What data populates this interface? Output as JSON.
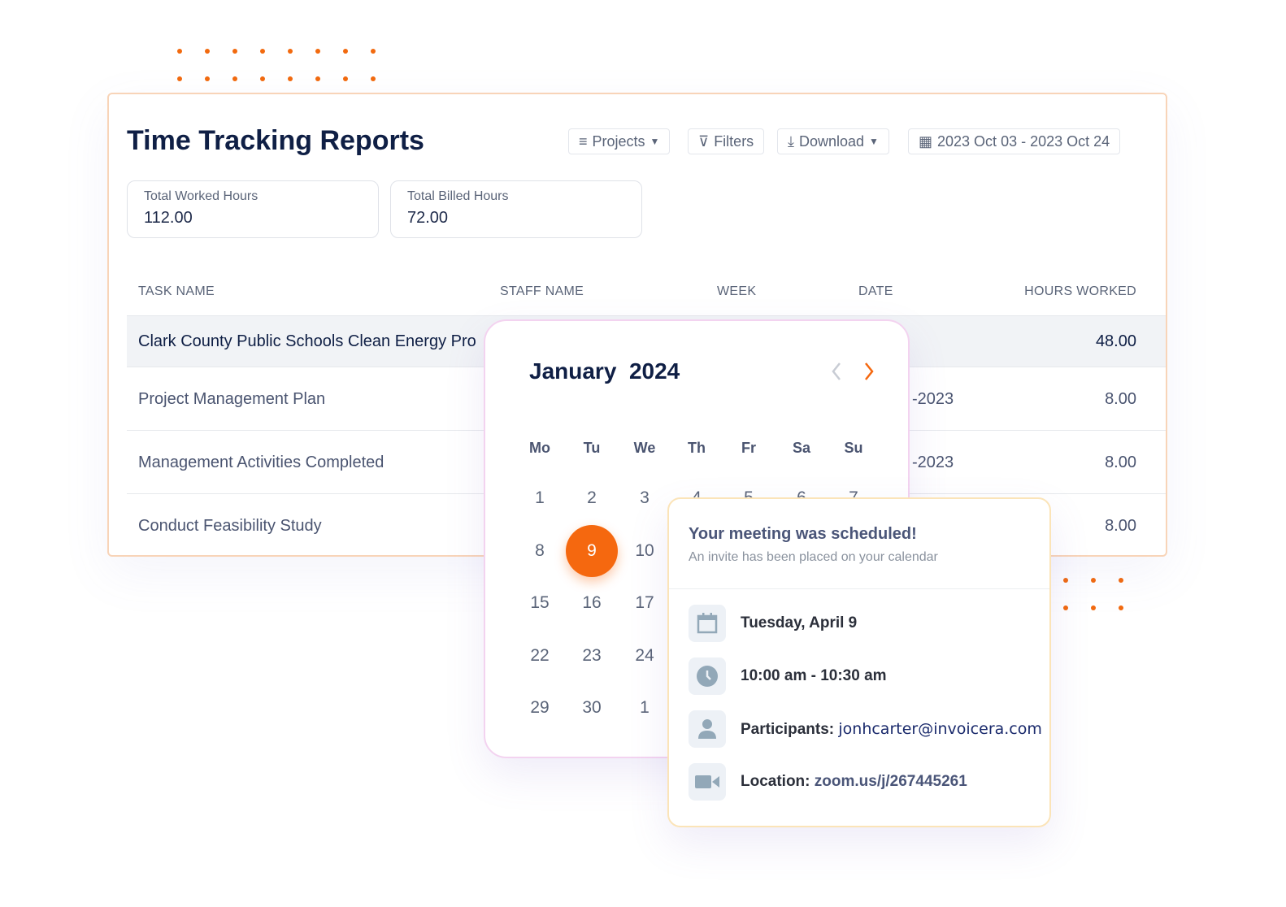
{
  "header": {
    "title": "Time Tracking Reports",
    "projects": "Projects",
    "filters": "Filters",
    "download": "Download",
    "date_range": "2023 Oct 03 - 2023 Oct 24"
  },
  "stats": [
    {
      "label": "Total Worked Hours",
      "value": "112.00"
    },
    {
      "label": "Total Billed Hours",
      "value": "72.00"
    }
  ],
  "table": {
    "headers": [
      "TASK NAME",
      "STAFF NAME",
      "WEEK",
      "DATE",
      "HOURS WORKED"
    ],
    "rows": [
      {
        "task": "Clark County Public Schools Clean Energy Pro",
        "date": "",
        "hours": "48.00"
      },
      {
        "task": "Project Management Plan",
        "date": "-2023",
        "hours": "8.00"
      },
      {
        "task": "Management Activities Completed",
        "date": "-2023",
        "hours": "8.00"
      },
      {
        "task": "Conduct Feasibility Study",
        "date": "",
        "hours": "8.00"
      }
    ]
  },
  "calendar": {
    "month": "January  2024",
    "weekdays": [
      "Mo",
      "Tu",
      "We",
      "Th",
      "Fr",
      "Sa",
      "Su"
    ],
    "selected": "9",
    "accent": "#f5680f",
    "weeks": [
      [
        "1",
        "2",
        "3",
        "4",
        "5",
        "6",
        "7"
      ],
      [
        "8",
        "9",
        "10",
        "",
        "",
        "",
        ""
      ],
      [
        "15",
        "16",
        "17",
        "",
        "",
        "",
        ""
      ],
      [
        "22",
        "23",
        "24",
        "",
        "",
        "",
        ""
      ],
      [
        "29",
        "30",
        "1",
        "",
        "",
        "",
        ""
      ]
    ]
  },
  "meeting": {
    "title": "Your meeting was scheduled!",
    "subtitle": "An invite has been placed on your calendar",
    "date": "Tuesday, April 9",
    "time": "10:00 am - 10:30 am",
    "participants_label": "Participants:",
    "participants": "jonhcarter@invoicera.com",
    "location_label": "Location:",
    "location": "zoom.us/j/267445261"
  }
}
